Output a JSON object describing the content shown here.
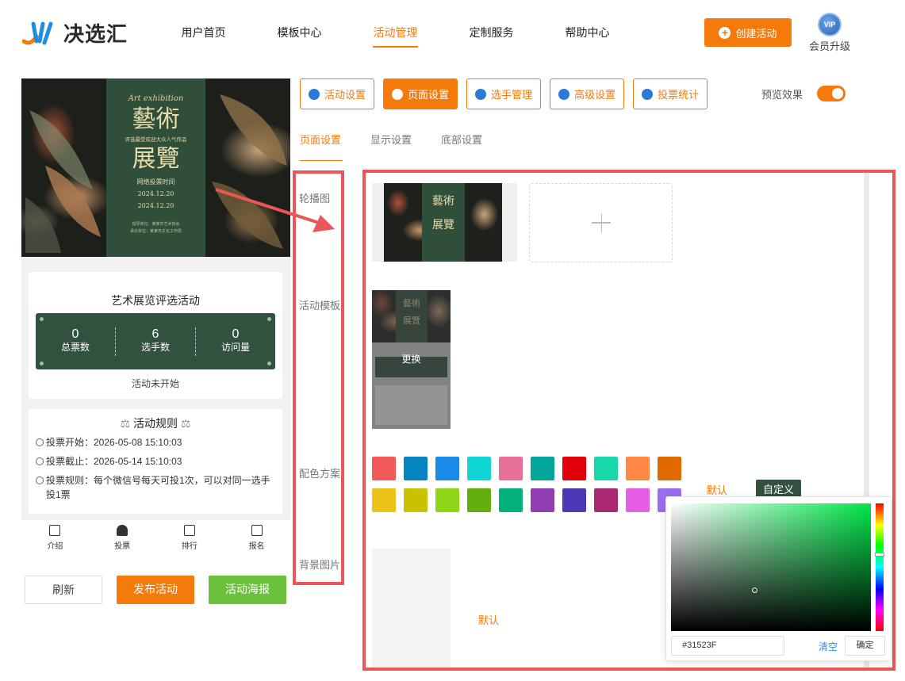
{
  "brand": {
    "name": "决选汇"
  },
  "nav": {
    "items": [
      {
        "label": "用户首页"
      },
      {
        "label": "模板中心"
      },
      {
        "label": "活动管理"
      },
      {
        "label": "定制服务"
      },
      {
        "label": "帮助中心"
      }
    ],
    "active_index": 2,
    "create_label": "创建活动",
    "vip_badge": "VIP",
    "vip_label": "会员升级"
  },
  "poster": {
    "script_title": "Art exhibition",
    "title_line1": "藝術",
    "subtitle": "评选最受欢迎大众人气作品",
    "title_line2": "展覽",
    "vote_time_label": "网络投票时间",
    "date_start": "2024.12.20",
    "date_end": "2024.12.20",
    "footer_line1": "指导单位：某某市艺术协会",
    "footer_line2": "承办单位：某某市文化工作局"
  },
  "activity": {
    "title": "艺术展览评选活动",
    "stats": [
      {
        "value": "0",
        "label": "总票数"
      },
      {
        "value": "6",
        "label": "选手数"
      },
      {
        "value": "0",
        "label": "访问量"
      }
    ],
    "status": "活动未开始",
    "rules_title": "活动规则",
    "rules": [
      "投票开始：2026-05-08 15:10:03",
      "投票截止：2026-05-14 15:10:03",
      "投票规则：每个微信号每天可投1次，可以对同一选手投1票"
    ]
  },
  "preview_tabbar": [
    {
      "label": "介绍"
    },
    {
      "label": "投票"
    },
    {
      "label": "排行"
    },
    {
      "label": "报名"
    }
  ],
  "preview_buttons": {
    "refresh": "刷新",
    "publish": "发布活动",
    "poster": "活动海报"
  },
  "toolbar": {
    "items": [
      {
        "label": "活动设置",
        "icon": "star-icon"
      },
      {
        "label": "页面设置",
        "icon": "gear-icon"
      },
      {
        "label": "选手管理",
        "icon": "users-icon"
      },
      {
        "label": "高级设置",
        "icon": "sliders-icon"
      },
      {
        "label": "投票统计",
        "icon": "bar-chart-icon"
      }
    ],
    "active_index": 1,
    "preview_label": "预览效果",
    "preview_on": true
  },
  "subtabs": {
    "items": [
      {
        "label": "页面设置"
      },
      {
        "label": "显示设置"
      },
      {
        "label": "底部设置"
      }
    ],
    "active_index": 0
  },
  "settings": {
    "labels": {
      "carousel": "轮播图",
      "template": "活动模板",
      "color_scheme": "配色方案",
      "background": "背景图片"
    },
    "template_change": "更换",
    "color_default": "默认",
    "color_custom": "自定义",
    "background_default": "默认",
    "swatches": [
      "#f25a5a",
      "#0585c0",
      "#1a8ae8",
      "#12d6d6",
      "#e86f99",
      "#04a59b",
      "#e0000a",
      "#19d7a9",
      "#ff8744",
      "#e06a00",
      "#ebc318",
      "#c8c200",
      "#8ed617",
      "#63ad0d",
      "#04b07a",
      "#8f3db0",
      "#4b39b5",
      "#aa2a71",
      "#e65ee3",
      "#9a6df0"
    ]
  },
  "color_picker": {
    "hex_value": "#31523F",
    "clear_label": "清空",
    "confirm_label": "确定"
  },
  "colors": {
    "accent": "#f57a0b",
    "theme_green": "#31523f",
    "annotation_red": "#ec5656"
  }
}
